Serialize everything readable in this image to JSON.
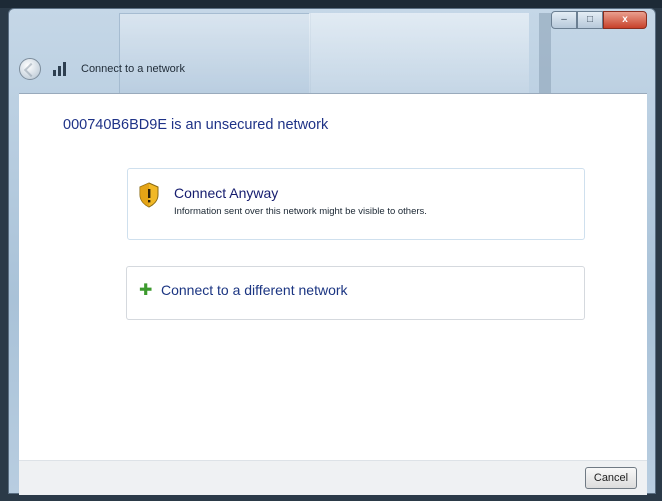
{
  "window": {
    "title": "Connect to a network",
    "caption": {
      "minimize": "–",
      "maximize": "□",
      "close": "x"
    }
  },
  "dialog": {
    "heading": "000740B6BD9E is an unsecured network",
    "options": [
      {
        "icon": "security-shield-icon",
        "label": "Connect Anyway",
        "description": "Information sent over this network might be visible to others."
      },
      {
        "icon": "green-arrow-icon",
        "label": "Connect to a different network"
      }
    ]
  },
  "footer": {
    "cancel_label": "Cancel"
  },
  "colors": {
    "heading": "#1e3287",
    "link": "#151c6e",
    "arrow": "#3d9a2e",
    "close_button": "#c8412a"
  }
}
